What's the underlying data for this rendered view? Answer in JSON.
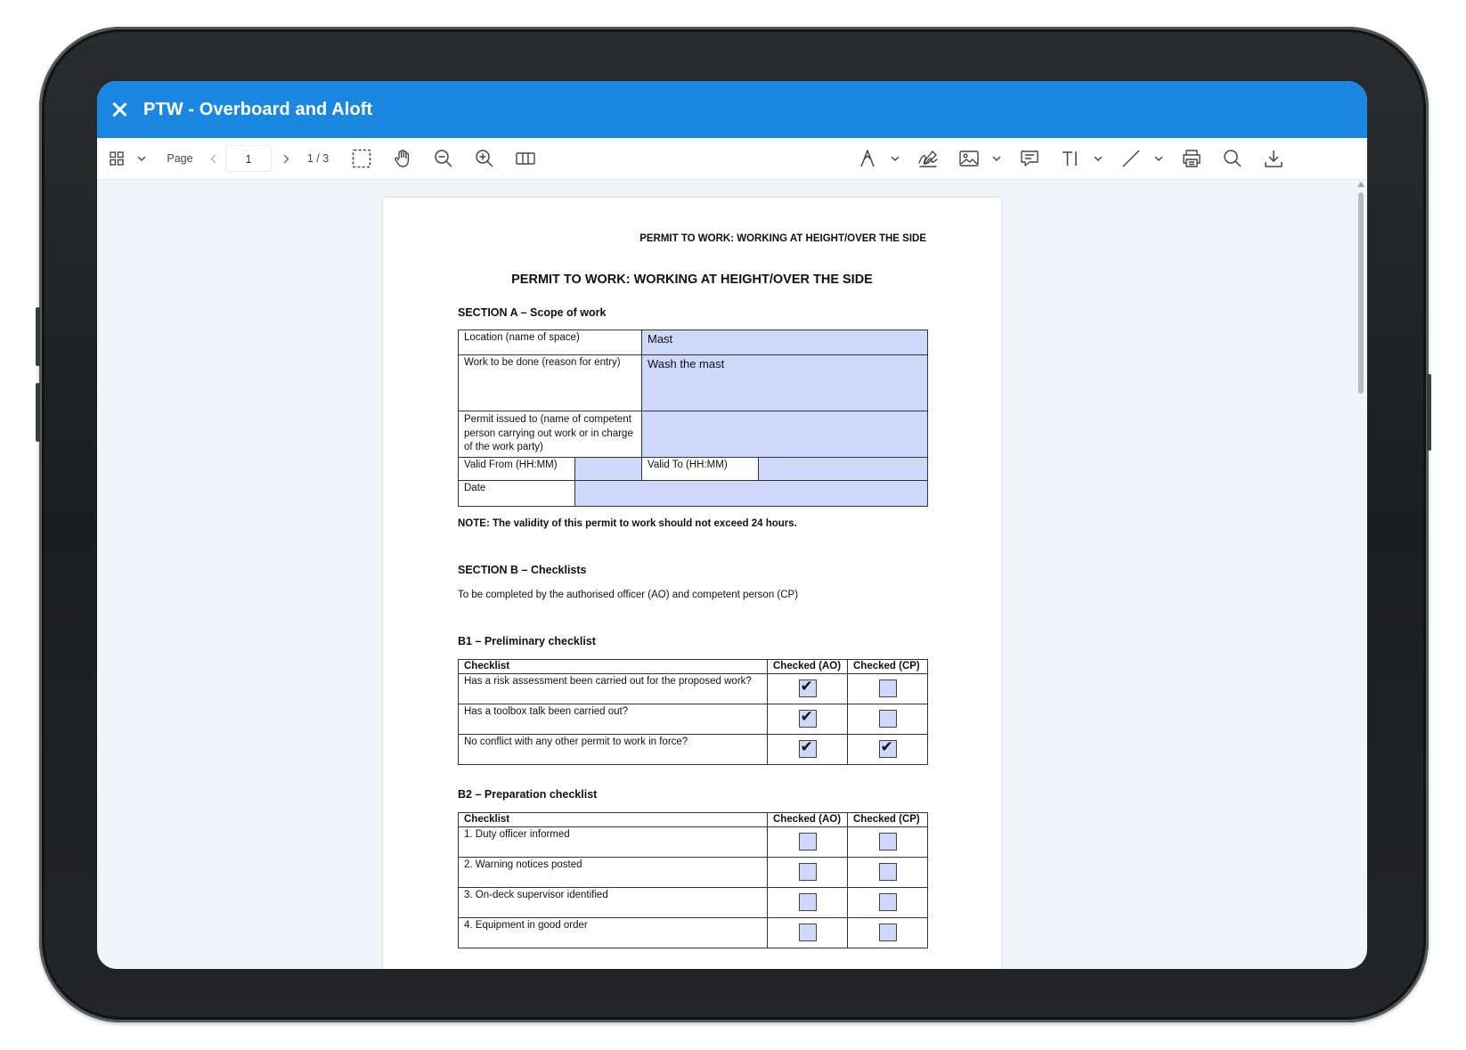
{
  "app": {
    "title": "PTW - Overboard and Aloft"
  },
  "toolbar": {
    "page_label": "Page",
    "page_value": "1",
    "page_total": "1 / 3"
  },
  "document": {
    "header_small": "PERMIT TO WORK: WORKING AT HEIGHT/OVER THE SIDE",
    "title": "PERMIT TO WORK: WORKING AT HEIGHT/OVER THE SIDE",
    "section_a": {
      "heading": "SECTION A – Scope of work",
      "location_label": "Location (name of space)",
      "location_value": "Mast",
      "work_label": "Work to be done (reason for entry)",
      "work_value": "Wash the mast",
      "issued_label": "Permit issued to (name of competent person carrying out work or in charge of the work party)",
      "issued_value": "",
      "valid_from_label": "Valid From (HH:MM)",
      "valid_from_value": "",
      "valid_to_label": "Valid To (HH:MM)",
      "valid_to_value": "",
      "date_label": "Date",
      "date_value": ""
    },
    "note": "NOTE: The validity of this permit to work should not exceed 24 hours.",
    "section_b": {
      "heading": "SECTION B – Checklists",
      "subtext": "To be completed by the authorised officer (AO) and competent person (CP)"
    },
    "b1": {
      "heading": "B1 – Preliminary checklist",
      "col_checklist": "Checklist",
      "col_ao": "Checked (AO)",
      "col_cp": "Checked (CP)",
      "rows": [
        {
          "label": "Has a risk assessment been carried out for the proposed work?",
          "ao": true,
          "cp": false
        },
        {
          "label": "Has a toolbox talk been carried out?",
          "ao": true,
          "cp": false
        },
        {
          "label": "No conflict with any other permit to work in force?",
          "ao": true,
          "cp": true
        }
      ]
    },
    "b2": {
      "heading": "B2 – Preparation checklist",
      "col_checklist": "Checklist",
      "col_ao": "Checked (AO)",
      "col_cp": "Checked (CP)",
      "rows": [
        {
          "label": "1. Duty officer informed",
          "ao": false,
          "cp": false
        },
        {
          "label": "2. Warning notices posted",
          "ao": false,
          "cp": false
        },
        {
          "label": "3. On-deck supervisor identified",
          "ao": false,
          "cp": false
        },
        {
          "label": "4. Equipment in good order",
          "ao": false,
          "cp": false
        }
      ]
    }
  },
  "icons": [
    "close-icon",
    "thumbnails-icon",
    "chevron-down-icon",
    "chevron-left-icon",
    "chevron-right-icon",
    "marquee-select-icon",
    "pan-hand-icon",
    "zoom-out-icon",
    "zoom-in-icon",
    "two-page-icon",
    "ink-pen-icon",
    "signature-icon",
    "image-icon",
    "comment-icon",
    "text-cursor-icon",
    "line-icon",
    "print-icon",
    "search-icon",
    "download-icon"
  ]
}
